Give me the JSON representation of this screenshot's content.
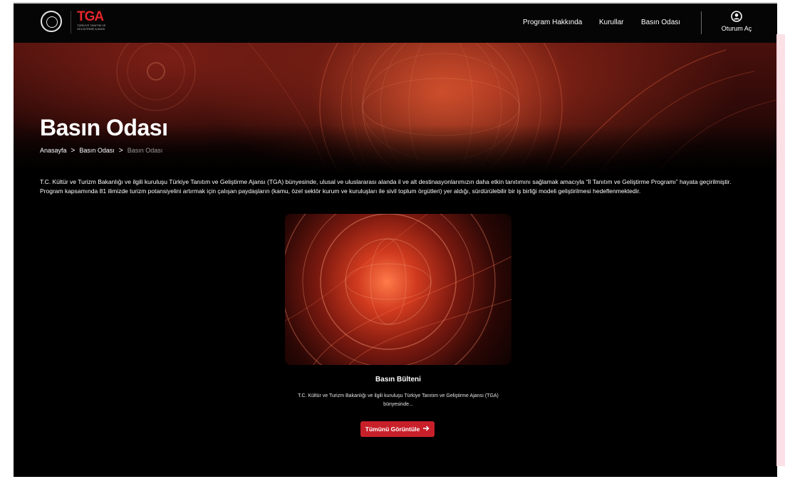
{
  "header": {
    "brand": "TGA",
    "brand_subtitle": "TÜRKİYE TANITIM VE GELİŞTİRME AJANSI",
    "nav": [
      {
        "label": "Program Hakkında"
      },
      {
        "label": "Kurullar"
      },
      {
        "label": "Basın Odası"
      }
    ],
    "login_label": "Oturum Aç"
  },
  "hero": {
    "title": "Basın Odası",
    "breadcrumb": [
      "Anasayfa",
      "Basın Odası",
      "Basın Odası"
    ]
  },
  "intro_text": "T.C. Kültür ve Turizm Bakanlığı ve ilgili kuruluşu Türkiye Tanıtım ve Geliştirme Ajansı (TGA) bünyesinde, ulusal ve uluslararası alanda il ve alt destinasyonlarımızın daha etkin tanıtımını sağlamak amacıyla “İl Tanıtım ve Geliştirme Programı” hayata geçirilmiştir. Program kapsamında 81 ilimizde turizm potansiyelini artırmak için çalışan paydaşların (kamu, özel sektör kurum ve kuruluşları ile sivil toplum örgütleri) yer aldığı, sürdürülebilir bir iş birliği modeli geliştirilmesi hedeflenmektedir.",
  "card": {
    "title": "Basın Bülteni",
    "description": "T.C. Kültür ve Turizm Bakanlığı ve ilgili kuruluşu Türkiye Tanıtım ve Geliştirme Ajansı (TGA) bünyesinde...",
    "button_label": "Tümünü Görüntüle",
    "button_icon": "arrow-right-icon"
  },
  "colors": {
    "accent": "#c8202a",
    "brand_red": "#e4262b",
    "background": "#000000"
  }
}
